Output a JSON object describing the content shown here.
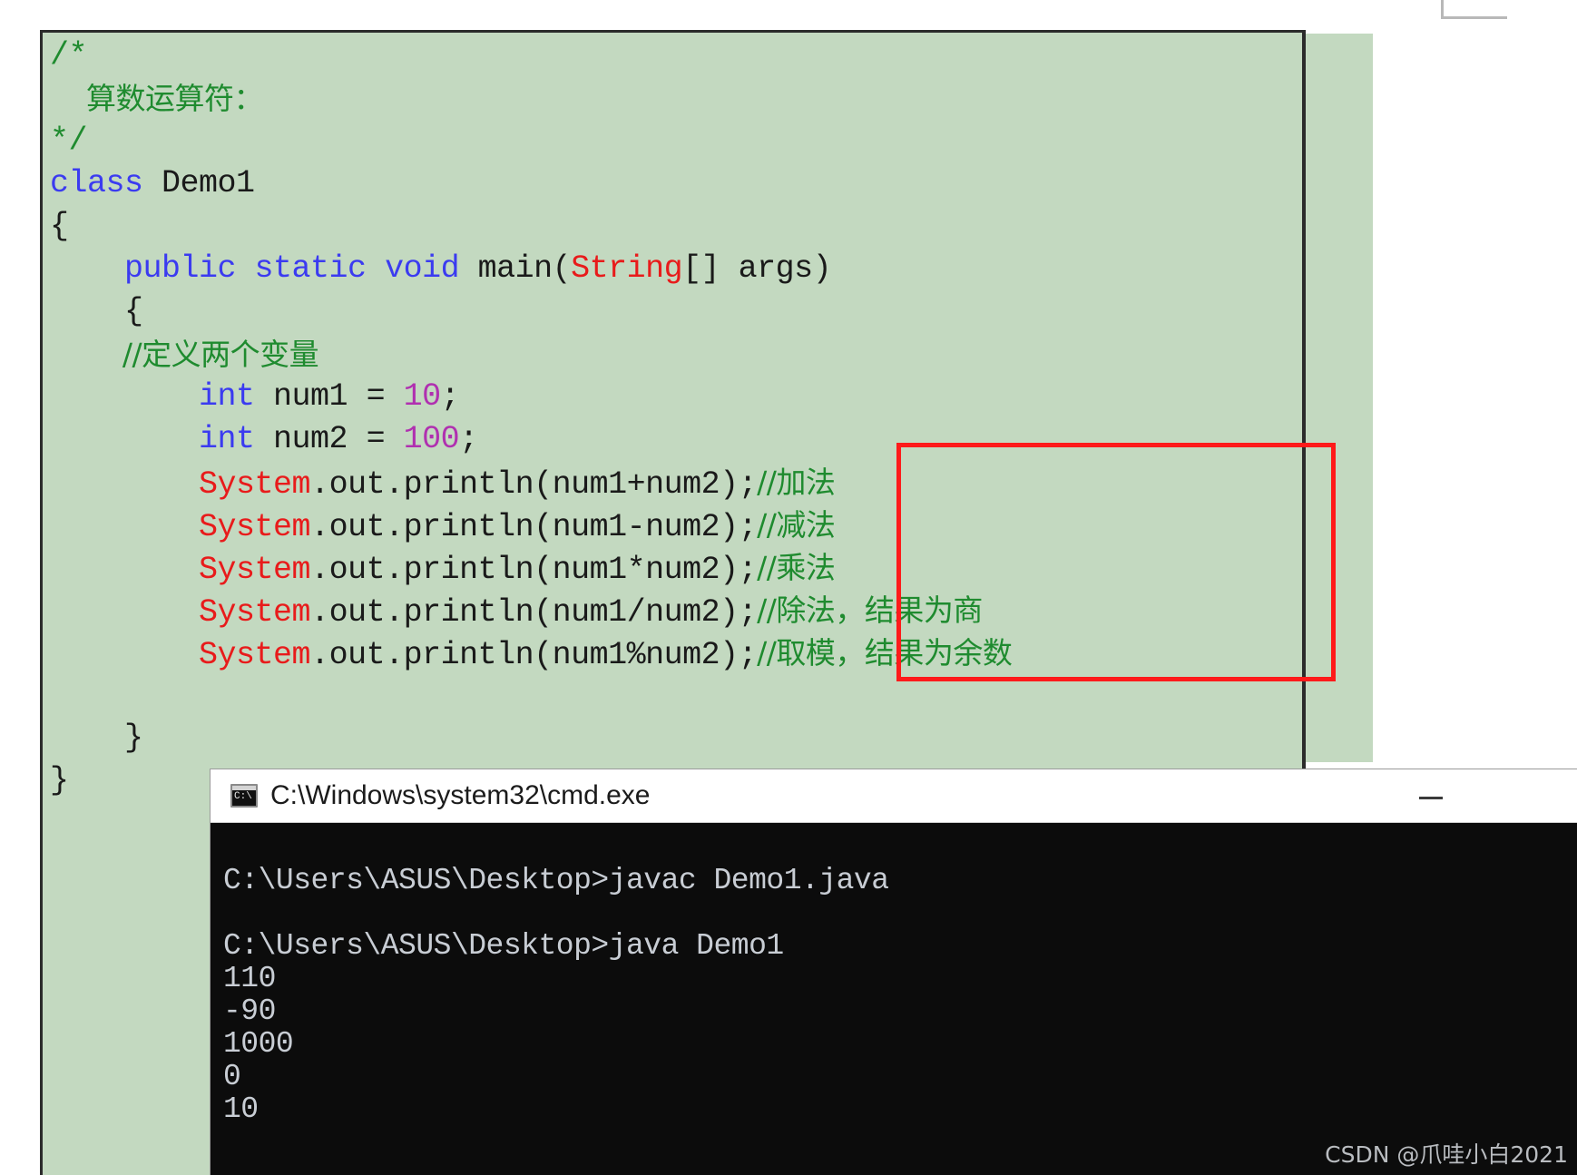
{
  "editor": {
    "background_color": "#c3d9c0",
    "code_lines": [
      {
        "tokens": [
          {
            "t": "/*",
            "c": "cmt"
          }
        ]
      },
      {
        "tokens": [
          {
            "t": "    算数运算符：",
            "c": "cmt cn"
          }
        ]
      },
      {
        "tokens": [
          {
            "t": "*/",
            "c": "cmt"
          }
        ]
      },
      {
        "tokens": [
          {
            "t": "class",
            "c": "kw"
          },
          {
            "t": " Demo1",
            "c": "plain"
          }
        ]
      },
      {
        "tokens": [
          {
            "t": "{",
            "c": "plain"
          }
        ]
      },
      {
        "tokens": [
          {
            "t": "    ",
            "c": "plain"
          },
          {
            "t": "public static void",
            "c": "kw"
          },
          {
            "t": " main(",
            "c": "plain"
          },
          {
            "t": "String",
            "c": "type"
          },
          {
            "t": "[] args)",
            "c": "plain"
          }
        ]
      },
      {
        "tokens": [
          {
            "t": "    {",
            "c": "plain"
          }
        ]
      },
      {
        "tokens": [
          {
            "t": "        //定义两个变量",
            "c": "cmt cn"
          }
        ]
      },
      {
        "tokens": [
          {
            "t": "        ",
            "c": "plain"
          },
          {
            "t": "int",
            "c": "kw"
          },
          {
            "t": " num1 = ",
            "c": "plain"
          },
          {
            "t": "10",
            "c": "num"
          },
          {
            "t": ";",
            "c": "plain"
          }
        ]
      },
      {
        "tokens": [
          {
            "t": "        ",
            "c": "plain"
          },
          {
            "t": "int",
            "c": "kw"
          },
          {
            "t": " num2 = ",
            "c": "plain"
          },
          {
            "t": "100",
            "c": "num"
          },
          {
            "t": ";",
            "c": "plain"
          }
        ]
      },
      {
        "tokens": [
          {
            "t": "        ",
            "c": "plain"
          },
          {
            "t": "System",
            "c": "type"
          },
          {
            "t": ".out.println(num1+num2);",
            "c": "plain"
          },
          {
            "t": "//加法",
            "c": "cmt cn"
          }
        ]
      },
      {
        "tokens": [
          {
            "t": "        ",
            "c": "plain"
          },
          {
            "t": "System",
            "c": "type"
          },
          {
            "t": ".out.println(num1-num2);",
            "c": "plain"
          },
          {
            "t": "//减法",
            "c": "cmt cn"
          }
        ]
      },
      {
        "tokens": [
          {
            "t": "        ",
            "c": "plain"
          },
          {
            "t": "System",
            "c": "type"
          },
          {
            "t": ".out.println(num1*num2);",
            "c": "plain"
          },
          {
            "t": "//乘法",
            "c": "cmt cn"
          }
        ]
      },
      {
        "tokens": [
          {
            "t": "        ",
            "c": "plain"
          },
          {
            "t": "System",
            "c": "type"
          },
          {
            "t": ".out.println(num1/num2);",
            "c": "plain"
          },
          {
            "t": "//除法，结果为商",
            "c": "cmt cn"
          }
        ]
      },
      {
        "tokens": [
          {
            "t": "        ",
            "c": "plain"
          },
          {
            "t": "System",
            "c": "type"
          },
          {
            "t": ".out.println(num1%num2);",
            "c": "plain"
          },
          {
            "t": "//取模，结果为余数",
            "c": "cmt cn"
          }
        ]
      },
      {
        "tokens": [
          {
            "t": "",
            "c": "plain"
          }
        ]
      },
      {
        "tokens": [
          {
            "t": "    }",
            "c": "plain"
          }
        ]
      },
      {
        "tokens": [
          {
            "t": "}",
            "c": "plain"
          }
        ]
      }
    ]
  },
  "annotation": {
    "red_box_color": "#ff1a1a",
    "highlighted_comments": [
      "//加法",
      "//减法",
      "//乘法",
      "//除法，结果为商",
      "//取模，结果为余数"
    ]
  },
  "cmd_window": {
    "title": "C:\\Windows\\system32\\cmd.exe",
    "icon": "console-icon",
    "minimize_label": "",
    "background_color": "#0c0c0c",
    "text_color": "#c8cdd4",
    "lines": [
      "",
      "C:\\Users\\ASUS\\Desktop>javac Demo1.java",
      "",
      "C:\\Users\\ASUS\\Desktop>java Demo1",
      "110",
      "-90",
      "1000",
      "0",
      "10"
    ]
  },
  "watermark": {
    "text": "CSDN @爪哇小白2021"
  }
}
